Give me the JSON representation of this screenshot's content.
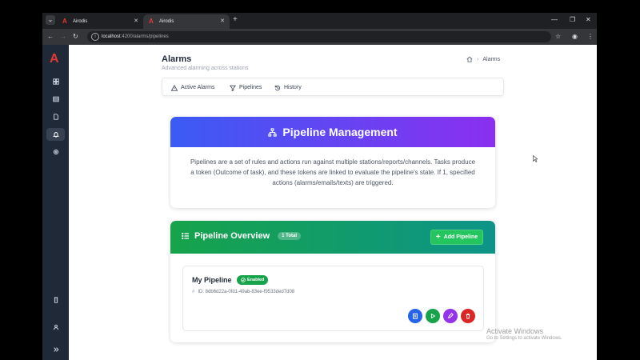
{
  "browser": {
    "tabs": [
      {
        "label": "Airodis"
      },
      {
        "label": "Airodis"
      }
    ],
    "url": "localhost:4200/alarms/pipelines",
    "url_host": "localhost",
    "url_path": ":4200/alarms/pipelines"
  },
  "sidebar": {
    "logo": "A",
    "items": [
      {
        "icon": "dashboard-icon"
      },
      {
        "icon": "table-icon"
      },
      {
        "icon": "file-icon"
      },
      {
        "icon": "bell-icon",
        "active": true
      },
      {
        "icon": "gear-icon"
      }
    ],
    "bottom": [
      {
        "icon": "building-icon"
      },
      {
        "icon": "user-icon"
      },
      {
        "icon": "expand-icon"
      }
    ]
  },
  "header": {
    "title": "Alarms",
    "subtitle": "Advanced alarming across stations",
    "breadcrumb_current": "Alarms"
  },
  "tabs": [
    {
      "label": "Active Alarms",
      "icon": "warning-icon"
    },
    {
      "label": "Pipelines",
      "icon": "filter-icon"
    },
    {
      "label": "History",
      "icon": "history-icon"
    }
  ],
  "management": {
    "title": "Pipeline Management",
    "description": "Pipelines are a set of rules and actions run against multiple stations/reports/channels. Tasks produce a token (Outcome of task), and these tokens are linked to evaluate the pipeline's state. If 1, specified actions (alarms/emails/texts) are triggered."
  },
  "overview": {
    "title": "Pipeline Overview",
    "count_badge": "1 Total",
    "add_label": "Add Pipeline",
    "pipelines": [
      {
        "name": "My Pipeline",
        "status": "Enabled",
        "id_text": "ID: 8db6d22a-0fd1-49ab-83ee-f9533ded7d08"
      }
    ]
  },
  "watermark": {
    "line1": "Activate Windows",
    "line2": "Go to Settings to activate Windows."
  },
  "colors": {
    "mgmt_gradient_start": "#3b5bf5",
    "mgmt_gradient_end": "#8b2ff0",
    "overview_gradient_start": "#16a34a",
    "overview_gradient_end": "#0d9488",
    "action_blue": "#2563eb",
    "action_green": "#16a34a",
    "action_purple": "#9333ea",
    "action_red": "#dc2626"
  }
}
